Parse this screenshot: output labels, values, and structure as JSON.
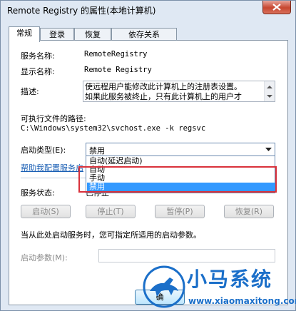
{
  "window": {
    "title": "Remote Registry 的属性(本地计算机)"
  },
  "tabs": [
    {
      "label": "常规"
    },
    {
      "label": "登录"
    },
    {
      "label": "恢复"
    },
    {
      "label": "依存关系"
    }
  ],
  "general": {
    "service_name_label": "服务名称:",
    "service_name": "RemoteRegistry",
    "display_name_label": "显示名称:",
    "display_name": "Remote Registry",
    "description_label": "描述:",
    "description_lines": [
      "使远程用户能修改此计算机上的注册表设置。",
      "如果此服务被终止，只有此计算机上的用户才"
    ],
    "exe_path_label": "可执行文件的路径:",
    "exe_path": "C:\\Windows\\system32\\svchost.exe -k regsvc",
    "startup_type_label": "启动类型(E):",
    "startup_type_value": "禁用",
    "startup_options": [
      "自动(延迟启动)",
      "自动",
      "手动",
      "禁用"
    ],
    "help_link": "帮助我配置服务启",
    "service_status_label": "服务状态:",
    "service_status_value": "已停止",
    "buttons": {
      "start": "启动(S)",
      "stop": "停止(T)",
      "pause": "暂停(P)",
      "resume": "恢复(R)"
    },
    "start_params_note": "当从此处启动服务时，您可指定所适用的启动参数。",
    "start_params_label": "启动参数(M):",
    "start_params_value": ""
  },
  "footer": {
    "ok_label": "确"
  },
  "watermark": {
    "brand": "小马系统",
    "url": "www.xiaomaxitong.com"
  },
  "colors": {
    "selection": "#3399ff",
    "highlight_box": "#d9313b",
    "link": "#1a5fb4"
  }
}
